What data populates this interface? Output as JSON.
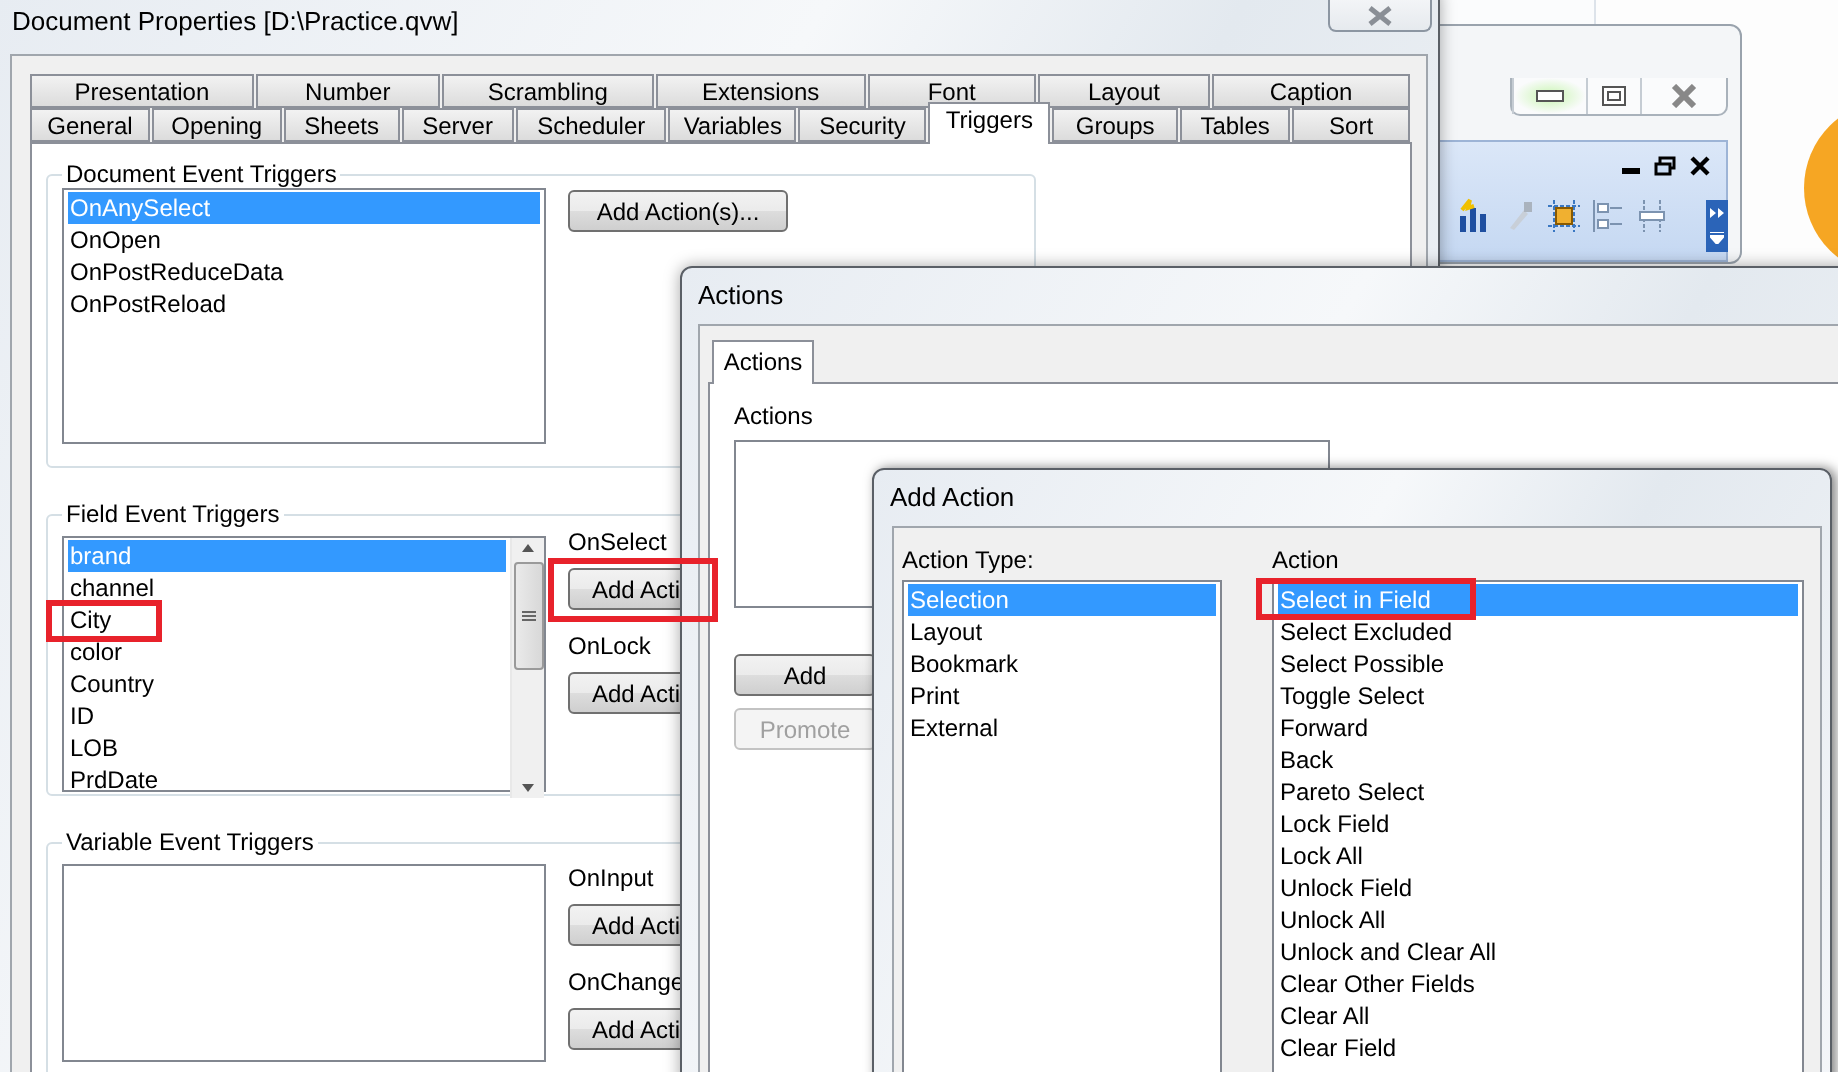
{
  "document_properties": {
    "title": "Document Properties [D:\\Practice.qvw]",
    "tab_rows": [
      [
        {
          "label": "Presentation",
          "selected": false
        },
        {
          "label": "Number",
          "selected": false
        },
        {
          "label": "Scrambling",
          "selected": false
        },
        {
          "label": "Extensions",
          "selected": false
        },
        {
          "label": "Font",
          "selected": false
        },
        {
          "label": "Layout",
          "selected": false
        },
        {
          "label": "Caption",
          "selected": false
        }
      ],
      [
        {
          "label": "General",
          "selected": false
        },
        {
          "label": "Opening",
          "selected": false
        },
        {
          "label": "Sheets",
          "selected": false
        },
        {
          "label": "Server",
          "selected": false
        },
        {
          "label": "Scheduler",
          "selected": false
        },
        {
          "label": "Variables",
          "selected": false
        },
        {
          "label": "Security",
          "selected": false
        },
        {
          "label": "Triggers",
          "selected": true
        },
        {
          "label": "Groups",
          "selected": false
        },
        {
          "label": "Tables",
          "selected": false
        },
        {
          "label": "Sort",
          "selected": false
        }
      ]
    ],
    "document_event_triggers": {
      "title": "Document Event Triggers",
      "button": "Add Action(s)...",
      "items": [
        {
          "label": "OnAnySelect",
          "selected": true
        },
        {
          "label": "OnOpen",
          "selected": false
        },
        {
          "label": "OnPostReduceData",
          "selected": false
        },
        {
          "label": "OnPostReload",
          "selected": false
        }
      ]
    },
    "field_event_triggers": {
      "title": "Field Event Triggers",
      "items": [
        {
          "label": "brand",
          "selected": true,
          "highlighted": false
        },
        {
          "label": "channel",
          "selected": false,
          "highlighted": false
        },
        {
          "label": "City",
          "selected": false,
          "highlighted": true
        },
        {
          "label": "color",
          "selected": false,
          "highlighted": false
        },
        {
          "label": "Country",
          "selected": false,
          "highlighted": false
        },
        {
          "label": "ID",
          "selected": false,
          "highlighted": false
        },
        {
          "label": "LOB",
          "selected": false,
          "highlighted": false
        },
        {
          "label": "PrdDate",
          "selected": false,
          "highlighted": false
        }
      ],
      "events": [
        {
          "label": "OnSelect",
          "button": "Add Acti",
          "highlighted": true
        },
        {
          "label": "OnLock",
          "button": "Add Acti",
          "highlighted": false
        }
      ]
    },
    "variable_event_triggers": {
      "title": "Variable Event Triggers",
      "events": [
        {
          "label": "OnInput",
          "button": "Add Acti",
          "highlighted": false
        },
        {
          "label": "OnChange",
          "button": "Add Acti",
          "highlighted": false
        }
      ]
    }
  },
  "actions_dialog": {
    "title": "Actions",
    "tabs": [
      {
        "label": "Actions",
        "selected": true
      }
    ],
    "list_label": "Actions",
    "buttons": [
      {
        "label": "Add",
        "disabled": false
      },
      {
        "label": "Promote",
        "disabled": true
      }
    ]
  },
  "add_action_dialog": {
    "title": "Add Action",
    "action_type": {
      "label": "Action Type:",
      "items": [
        {
          "label": "Selection",
          "selected": true,
          "highlighted": false
        },
        {
          "label": "Layout",
          "selected": false,
          "highlighted": false
        },
        {
          "label": "Bookmark",
          "selected": false,
          "highlighted": false
        },
        {
          "label": "Print",
          "selected": false,
          "highlighted": false
        },
        {
          "label": "External",
          "selected": false,
          "highlighted": false
        }
      ]
    },
    "action": {
      "label": "Action",
      "items": [
        {
          "label": "Select in Field",
          "selected": true,
          "highlighted": true
        },
        {
          "label": "Select Excluded",
          "selected": false,
          "highlighted": false
        },
        {
          "label": "Select Possible",
          "selected": false,
          "highlighted": false
        },
        {
          "label": "Toggle Select",
          "selected": false,
          "highlighted": false
        },
        {
          "label": "Forward",
          "selected": false,
          "highlighted": false
        },
        {
          "label": "Back",
          "selected": false,
          "highlighted": false
        },
        {
          "label": "Pareto Select",
          "selected": false,
          "highlighted": false
        },
        {
          "label": "Lock Field",
          "selected": false,
          "highlighted": false
        },
        {
          "label": "Lock All",
          "selected": false,
          "highlighted": false
        },
        {
          "label": "Unlock Field",
          "selected": false,
          "highlighted": false
        },
        {
          "label": "Unlock All",
          "selected": false,
          "highlighted": false
        },
        {
          "label": "Unlock and Clear All",
          "selected": false,
          "highlighted": false
        },
        {
          "label": "Clear Other Fields",
          "selected": false,
          "highlighted": false
        },
        {
          "label": "Clear All",
          "selected": false,
          "highlighted": false
        },
        {
          "label": "Clear Field",
          "selected": false,
          "highlighted": false
        }
      ]
    }
  }
}
